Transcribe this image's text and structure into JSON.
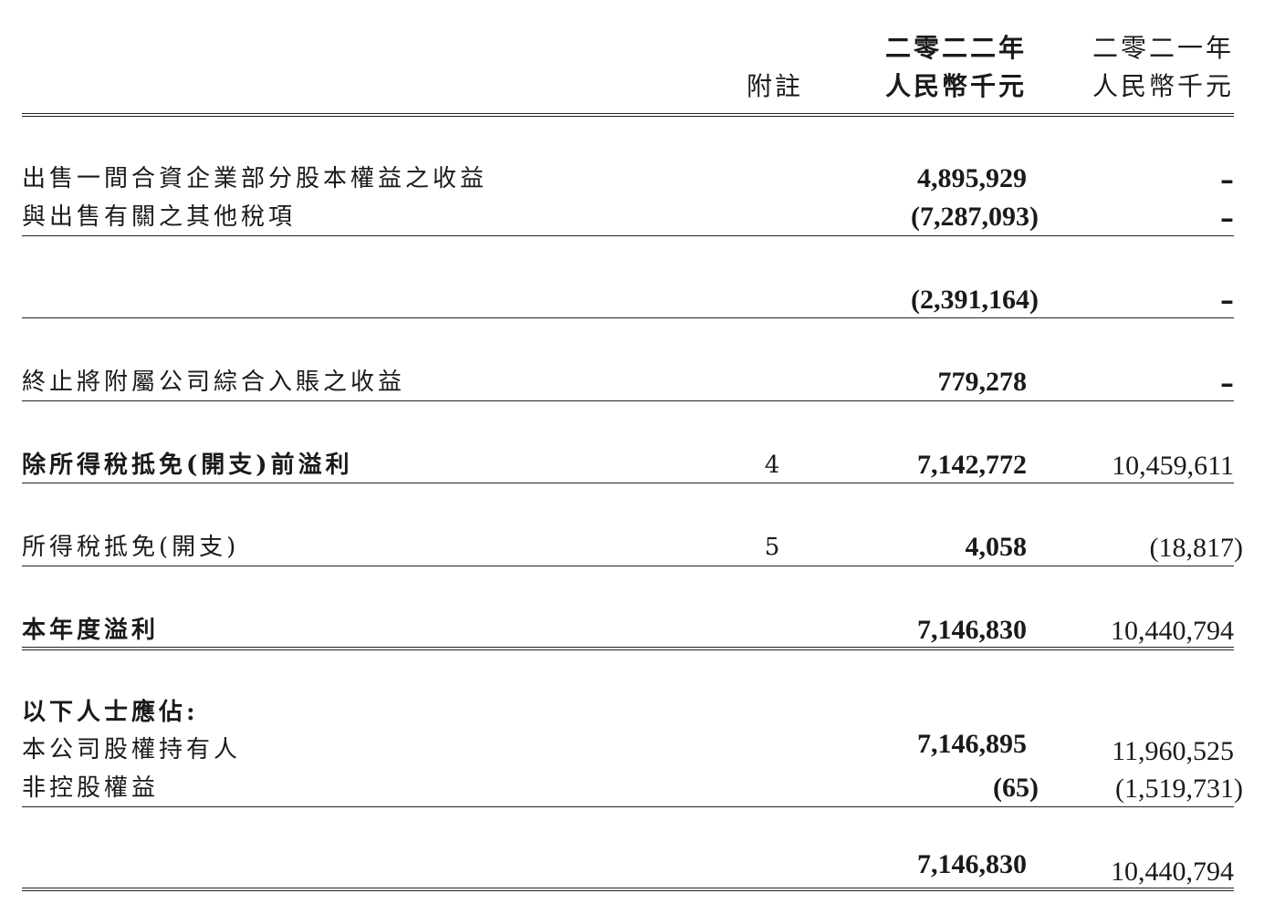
{
  "header": {
    "note_label": "附註",
    "col_2022_year": "二零二二年",
    "col_2022_unit": "人民幣千元",
    "col_2021_year": "二零二一年",
    "col_2021_unit": "人民幣千元"
  },
  "rows": {
    "r1": {
      "label": "出售一間合資企業部分股本權益之收益",
      "v2022": "4,895,929",
      "v2021": "–"
    },
    "r2": {
      "label": "與出售有關之其他稅項",
      "v2022": "(7,287,093)",
      "v2021": "–"
    },
    "r3": {
      "v2022": "(2,391,164)",
      "v2021": "–"
    },
    "r4": {
      "label": "終止將附屬公司綜合入賬之收益",
      "v2022": "779,278",
      "v2021": "–"
    },
    "r5": {
      "label": "除所得稅抵免(開支)前溢利",
      "note": "4",
      "v2022": "7,142,772",
      "v2021": "10,459,611"
    },
    "r6": {
      "label": "所得稅抵免(開支)",
      "note": "5",
      "v2022": "4,058",
      "v2021": "(18,817)"
    },
    "r7": {
      "label": "本年度溢利",
      "v2022": "7,146,830",
      "v2021": "10,440,794"
    },
    "r8": {
      "label": "以下人士應佔:"
    },
    "r9": {
      "label": "本公司股權持有人",
      "v2022": "7,146,895",
      "v2021": "11,960,525"
    },
    "r10": {
      "label": "非控股權益",
      "v2022": "(65)",
      "v2021": "(1,519,731)"
    },
    "r11": {
      "v2022": "7,146,830",
      "v2021": "10,440,794"
    }
  }
}
